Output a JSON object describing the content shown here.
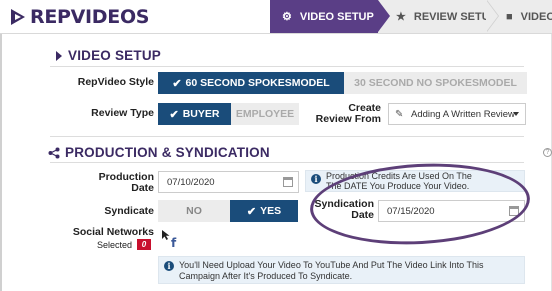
{
  "app": {
    "logo_text": "REPVIDEOS",
    "brand_color": "#3b2a63",
    "accent_color": "#1a4c7a",
    "annotation_color": "#5d3f78"
  },
  "steps": [
    {
      "label": "VIDEO SETUP",
      "icon": "gears-icon",
      "active": true
    },
    {
      "label": "REVIEW SETUP",
      "icon": "star-icon",
      "active": false
    },
    {
      "label": "VIDEO",
      "icon": "video-camera-icon",
      "active": false
    }
  ],
  "video_setup": {
    "title": "VIDEO SETUP",
    "style_label": "RepVideo Style",
    "style_options": [
      "60 SECOND SPOKESMODEL",
      "30 SECOND NO SPOKESMODEL"
    ],
    "style_selected": "60 SECOND SPOKESMODEL",
    "review_type_label": "Review Type",
    "review_type_options": [
      "BUYER",
      "EMPLOYEE"
    ],
    "review_type_selected": "BUYER",
    "create_review_label_1": "Create",
    "create_review_label_2": "Review From",
    "create_review_value": "Adding A Written Review"
  },
  "production": {
    "title": "PRODUCTION & SYNDICATION",
    "production_date_label_1": "Production",
    "production_date_label_2": "Date",
    "production_date_value": "07/10/2020",
    "info_credits_line1": "Production Credits Are Used On The",
    "info_credits_line2": "The DATE You Produce Your Video.",
    "syndicate_label": "Syndicate",
    "syndicate_options": [
      "NO",
      "YES"
    ],
    "syndicate_selected": "YES",
    "syndication_date_label_1": "Syndication",
    "syndication_date_label_2": "Date",
    "syndication_date_value": "07/15/2020",
    "social_label": "Social Networks",
    "selected_label": "Selected",
    "selected_count": "0",
    "social_icon": "f",
    "info_youtube_line1": "You'll Need Upload Your Video To YouTube And Put The Video Link Into This",
    "info_youtube_line2": "Campaign After It's Produced To Syndicate."
  }
}
